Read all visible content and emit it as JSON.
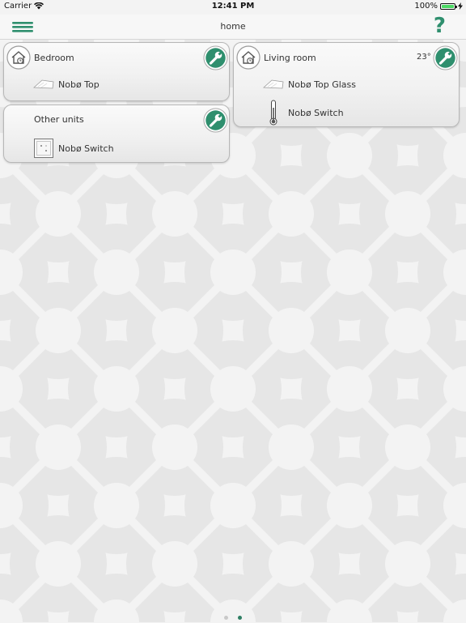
{
  "status_bar": {
    "carrier": "Carrier",
    "time": "12:41 PM",
    "battery": "100%"
  },
  "nav": {
    "title": "home",
    "help_label": "?"
  },
  "zones": [
    {
      "name": "Bedroom",
      "temperature": "",
      "devices": [
        {
          "name": "Nobø Top",
          "icon": "heater-panel-icon"
        }
      ]
    },
    {
      "name": "Living room",
      "temperature": "23°",
      "devices": [
        {
          "name": "Nobø Top Glass",
          "icon": "heater-panel-icon"
        },
        {
          "name": "Nobø Switch",
          "icon": "thermometer-icon"
        }
      ]
    },
    {
      "name": "Other units",
      "temperature": "",
      "devices": [
        {
          "name": "Nobø Switch",
          "icon": "wall-switch-icon"
        }
      ]
    }
  ],
  "pager": {
    "page_count": 2,
    "active_page": 2
  },
  "colors": {
    "accent": "#2f8f6e",
    "pager_active": "#2f7f63",
    "battery": "#4cd964"
  }
}
